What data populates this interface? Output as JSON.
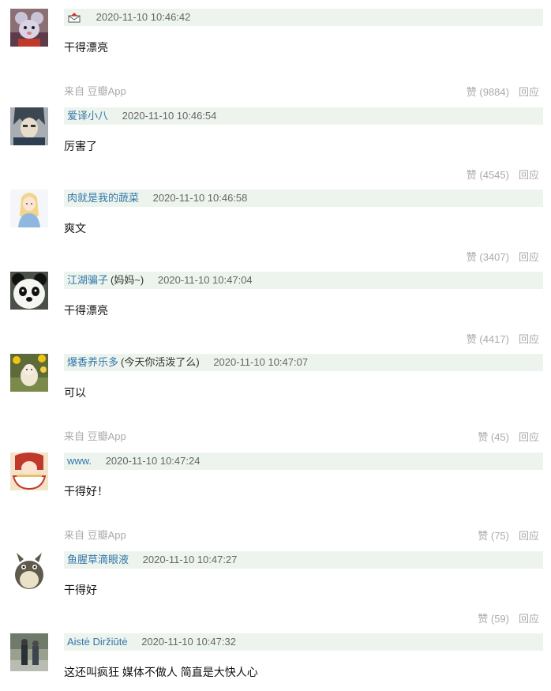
{
  "comments": [
    {
      "username": "",
      "user_status": "",
      "timestamp": "2020-11-10 10:46:42",
      "content": "干得漂亮",
      "source": "来自 豆瓣App",
      "like_label": "赞 (9884)",
      "reply_label": "回应",
      "avatar_icon": "cartoon-mouse-avatar",
      "user_icon": "envelope-icon"
    },
    {
      "username": "爱译小八",
      "user_status": "",
      "timestamp": "2020-11-10 10:46:54",
      "content": "厉害了",
      "source": "",
      "like_label": "赞 (4545)",
      "reply_label": "回应",
      "avatar_icon": "anime-character-avatar"
    },
    {
      "username": "肉就是我的蔬菜",
      "user_status": "",
      "timestamp": "2020-11-10 10:46:58",
      "content": "爽文",
      "source": "",
      "like_label": "赞 (3407)",
      "reply_label": "回应",
      "avatar_icon": "illustrated-girl-avatar"
    },
    {
      "username": "江湖骗子",
      "user_status": "(妈妈~)",
      "timestamp": "2020-11-10 10:47:04",
      "content": "干得漂亮",
      "source": "",
      "like_label": "赞 (4417)",
      "reply_label": "回应",
      "avatar_icon": "panda-avatar"
    },
    {
      "username": "爆香养乐多",
      "user_status": "(今天你活泼了么)",
      "timestamp": "2020-11-10 10:47:07",
      "content": "可以",
      "source": "来自 豆瓣App",
      "like_label": "赞 (45)",
      "reply_label": "回应",
      "avatar_icon": "lamb-flowers-avatar"
    },
    {
      "username": "www.",
      "user_status": "",
      "timestamp": "2020-11-10 10:47:24",
      "content": "干得好！",
      "source": "来自 豆瓣App",
      "like_label": "赞 (75)",
      "reply_label": "回应",
      "avatar_icon": "anime-eating-avatar"
    },
    {
      "username": "鱼腥草滴眼液",
      "user_status": "",
      "timestamp": "2020-11-10 10:47:27",
      "content": "干得好",
      "source": "",
      "like_label": "赞 (59)",
      "reply_label": "回应",
      "avatar_icon": "totoro-avatar"
    },
    {
      "username": "Aistė Diržiūtė",
      "user_status": "",
      "timestamp": "2020-11-10 10:47:32",
      "content": "这还叫疯狂 媒体不做人 简直是大快人心",
      "source": "",
      "like_label": "",
      "reply_label": "",
      "avatar_icon": "street-photo-avatar"
    }
  ],
  "colors": {
    "header_bg": "#edf4ed",
    "username": "#3377aa",
    "muted": "#aaaaaa",
    "content": "#111111"
  }
}
